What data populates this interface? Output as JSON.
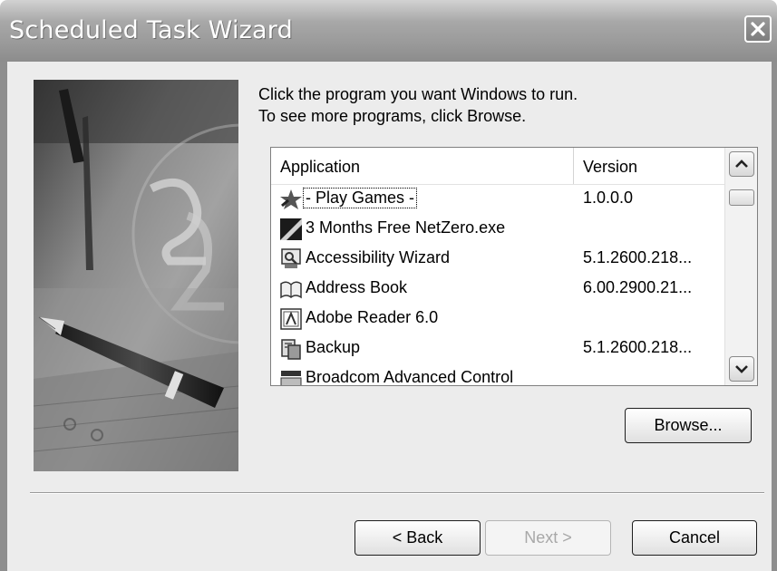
{
  "window": {
    "title": "Scheduled Task Wizard"
  },
  "instructions": {
    "line1": "Click the program you want Windows to run.",
    "line2": "To see more programs, click Browse."
  },
  "list": {
    "columns": {
      "application": "Application",
      "version": "Version"
    },
    "rows": [
      {
        "name": "- Play Games -",
        "version": "1.0.0.0",
        "icon": "star-icon"
      },
      {
        "name": "3 Months Free NetZero.exe",
        "version": "",
        "icon": "netzero-icon"
      },
      {
        "name": "Accessibility Wizard",
        "version": "5.1.2600.218...",
        "icon": "accessibility-wizard-icon"
      },
      {
        "name": "Address Book",
        "version": "6.00.2900.21...",
        "icon": "address-book-icon"
      },
      {
        "name": "Adobe Reader 6.0",
        "version": "",
        "icon": "adobe-reader-icon"
      },
      {
        "name": "Backup",
        "version": "5.1.2600.218...",
        "icon": "backup-icon"
      },
      {
        "name": "Broadcom Advanced Control",
        "version": "",
        "icon": "broadcom-icon"
      }
    ]
  },
  "buttons": {
    "browse": "Browse...",
    "back": "< Back",
    "next": "Next >",
    "cancel": "Cancel"
  },
  "icons": {
    "close": "close-icon",
    "scroll_up": "scroll-up-icon",
    "scroll_down": "scroll-down-icon"
  },
  "colors": {
    "titlebar": "#9a9a9a",
    "dialog_background": "#ececec",
    "list_background": "#ffffff"
  }
}
